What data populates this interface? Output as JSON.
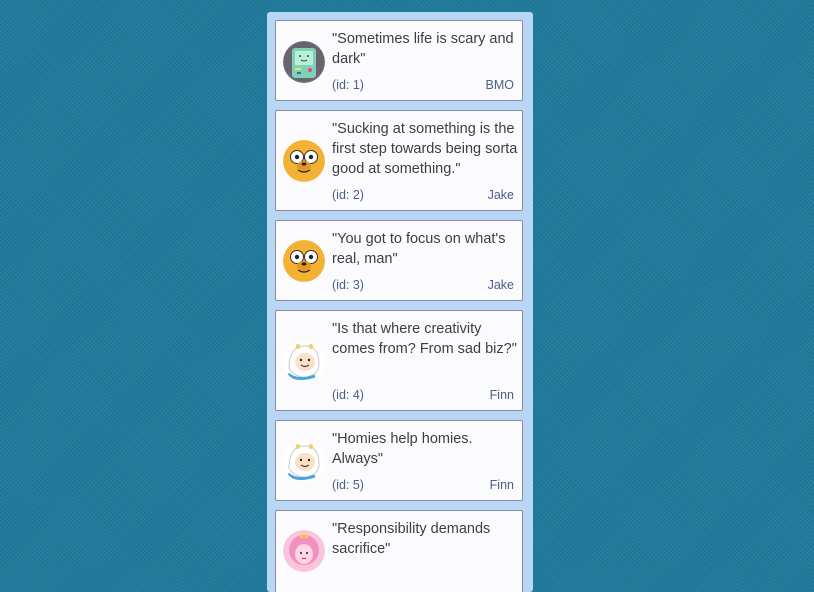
{
  "quotes": [
    {
      "text": "\"Sometimes life is scary and dark\"",
      "id_label": "(id: 1)",
      "author": "BMO",
      "avatar_icon": "bmo-avatar-icon"
    },
    {
      "text": "\"Sucking at something is the first step towards being sorta good at something.\"",
      "id_label": "(id: 2)",
      "author": "Jake",
      "avatar_icon": "jake-avatar-icon"
    },
    {
      "text": "\"You got to focus on what's real, man\"",
      "id_label": "(id: 3)",
      "author": "Jake",
      "avatar_icon": "jake-avatar-icon"
    },
    {
      "text": "\"Is that where creativity comes from? From sad biz?\"",
      "id_label": "(id: 4)",
      "author": "Finn",
      "avatar_icon": "finn-avatar-icon"
    },
    {
      "text": "\"Homies help homies. Always\"",
      "id_label": "(id: 5)",
      "author": "Finn",
      "avatar_icon": "finn-avatar-icon"
    },
    {
      "text": "\"Responsibility demands sacrifice\"",
      "id_label": "",
      "author": "",
      "avatar_icon": "princess-bubblegum-avatar-icon"
    }
  ],
  "colors": {
    "background": "#1f7a9c",
    "column": "#b9d6f6",
    "card": "#fbfbfd",
    "meta_text": "#4a5f86"
  }
}
